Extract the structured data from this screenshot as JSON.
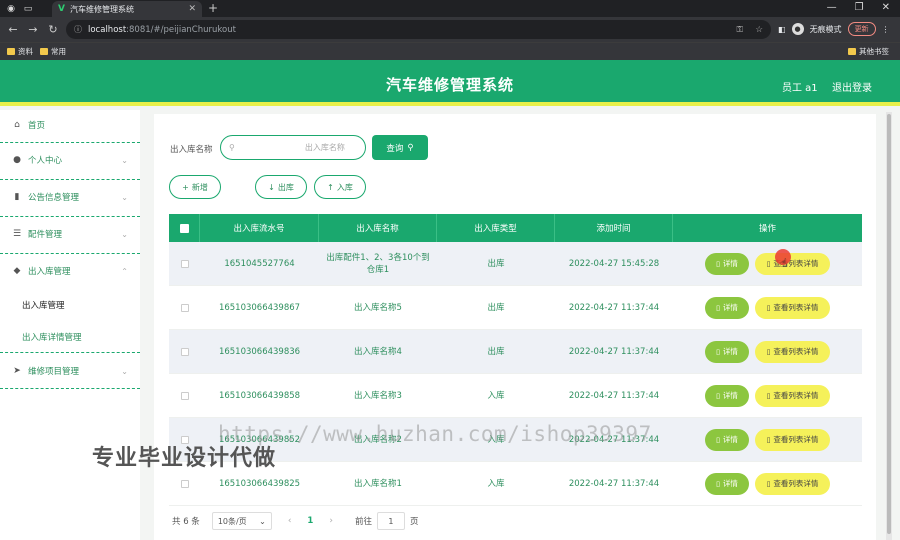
{
  "browser": {
    "tab_title": "汽车维修管理系统",
    "tab_favicon": "V",
    "url_host": "localhost",
    "url_path": ":8081/#/peijianChurukout",
    "incognito_label": "无痕模式",
    "update_label": "更新",
    "bookmarks": [
      "资料",
      "常用"
    ],
    "other_bookmarks": "其他书签"
  },
  "header": {
    "title": "汽车维修管理系统",
    "user": "员工 a1",
    "logout": "退出登录",
    "colors": {
      "primary": "#1aa86e",
      "accent": "#e8f049"
    }
  },
  "sidebar": {
    "items": [
      {
        "label": "首页",
        "icon": "home-icon"
      },
      {
        "label": "个人中心",
        "icon": "user-icon"
      },
      {
        "label": "公告信息管理",
        "icon": "chart-icon"
      },
      {
        "label": "配件管理",
        "icon": "sliders-icon"
      },
      {
        "label": "出入库管理",
        "icon": "shield-icon"
      },
      {
        "label": "维修项目管理",
        "icon": "send-icon"
      }
    ],
    "submenu": [
      "出入库管理",
      "出入库详情管理"
    ]
  },
  "search": {
    "label": "出入库名称",
    "placeholder": "出入库名称",
    "query_button": "查询"
  },
  "actions": {
    "add": "新增",
    "out": "出库",
    "in": "入库"
  },
  "table": {
    "headers": [
      "出入库流水号",
      "出入库名称",
      "出入库类型",
      "添加时间",
      "操作"
    ],
    "detail_button": "详情",
    "list_button": "查看列表详情",
    "rows": [
      {
        "serial": "1651045527764",
        "name": "出库配件1、2、3各10个到仓库1",
        "type": "出库",
        "time": "2022-04-27 15:45:28"
      },
      {
        "serial": "165103066439867",
        "name": "出入库名称5",
        "type": "出库",
        "time": "2022-04-27 11:37:44"
      },
      {
        "serial": "165103066439836",
        "name": "出入库名称4",
        "type": "出库",
        "time": "2022-04-27 11:37:44"
      },
      {
        "serial": "165103066439858",
        "name": "出入库名称3",
        "type": "入库",
        "time": "2022-04-27 11:37:44"
      },
      {
        "serial": "165103066439852",
        "name": "出入库名称2",
        "type": "入库",
        "time": "2022-04-27 11:37:44"
      },
      {
        "serial": "165103066439825",
        "name": "出入库名称1",
        "type": "入库",
        "time": "2022-04-27 11:37:44"
      }
    ]
  },
  "pagination": {
    "total": "共 6 条",
    "page_size": "10条/页",
    "current_page": "1",
    "jump_label": "前往",
    "jump_value": "1",
    "page_suffix": "页"
  },
  "overlay": {
    "watermark": "https://www.huzhan.com/ishop39397",
    "promo": "专业毕业设计代做"
  }
}
